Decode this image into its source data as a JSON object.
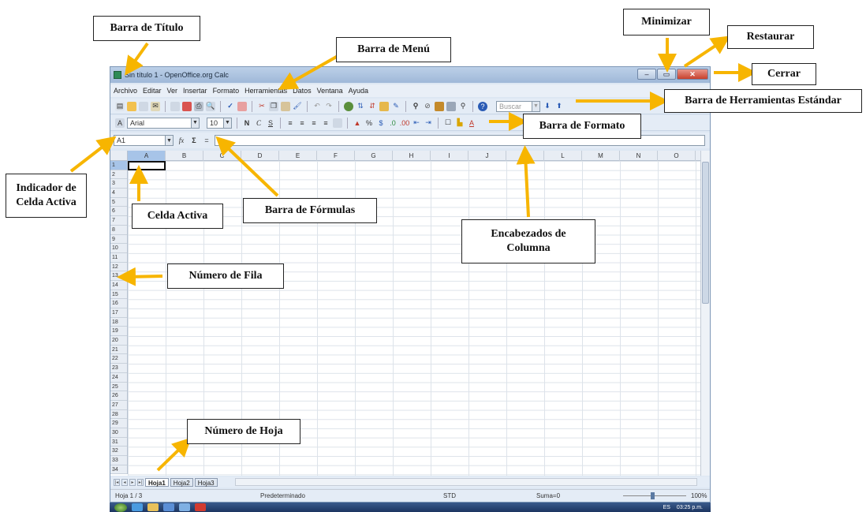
{
  "labels": {
    "titulo": "Barra de Título",
    "menu": "Barra de Menú",
    "minimizar": "Minimizar",
    "restaurar": "Restaurar",
    "cerrar": "Cerrar",
    "herramientas": "Barra de Herramientas Estándar",
    "formato": "Barra de Formato",
    "indicador_1": "Indicador de",
    "indicador_2": "Celda Activa",
    "celda_activa": "Celda Activa",
    "formulas": "Barra de Fórmulas",
    "encabezados_1": "Encabezados de",
    "encabezados_2": "Columna",
    "fila": "Número de Fila",
    "hoja": "Número de Hoja"
  },
  "window": {
    "title": "Sin título 1 - OpenOffice.org Calc"
  },
  "menu": [
    "Archivo",
    "Editar",
    "Ver",
    "Insertar",
    "Formato",
    "Herramientas",
    "Datos",
    "Ventana",
    "Ayuda"
  ],
  "toolbar": {
    "search_placeholder": "Buscar"
  },
  "format_bar": {
    "font": "Arial",
    "size": "10",
    "bold": "N",
    "italic": "C",
    "underline": "S"
  },
  "formula_bar": {
    "cell_ref": "A1",
    "fx": "fx",
    "sum": "Σ",
    "equals": "="
  },
  "columns": [
    "A",
    "B",
    "C",
    "D",
    "E",
    "F",
    "G",
    "H",
    "I",
    "J",
    "K",
    "L",
    "M",
    "N",
    "O"
  ],
  "rows": [
    "1",
    "2",
    "3",
    "4",
    "5",
    "6",
    "7",
    "8",
    "9",
    "10",
    "11",
    "12",
    "13",
    "14",
    "15",
    "16",
    "17",
    "18",
    "19",
    "20",
    "21",
    "22",
    "23",
    "24",
    "25",
    "26",
    "27",
    "28",
    "29",
    "30",
    "31",
    "32",
    "33",
    "34"
  ],
  "sheets": [
    "Hoja1",
    "Hoja2",
    "Hoja3"
  ],
  "status": {
    "sheet": "Hoja 1 / 3",
    "style": "Predeterminado",
    "mode": "STD",
    "sum": "Suma=0",
    "zoom": "100%"
  },
  "tray": {
    "lang": "ES",
    "time": "03:25 p.m."
  },
  "colors": {
    "arrow": "#f7b500"
  }
}
